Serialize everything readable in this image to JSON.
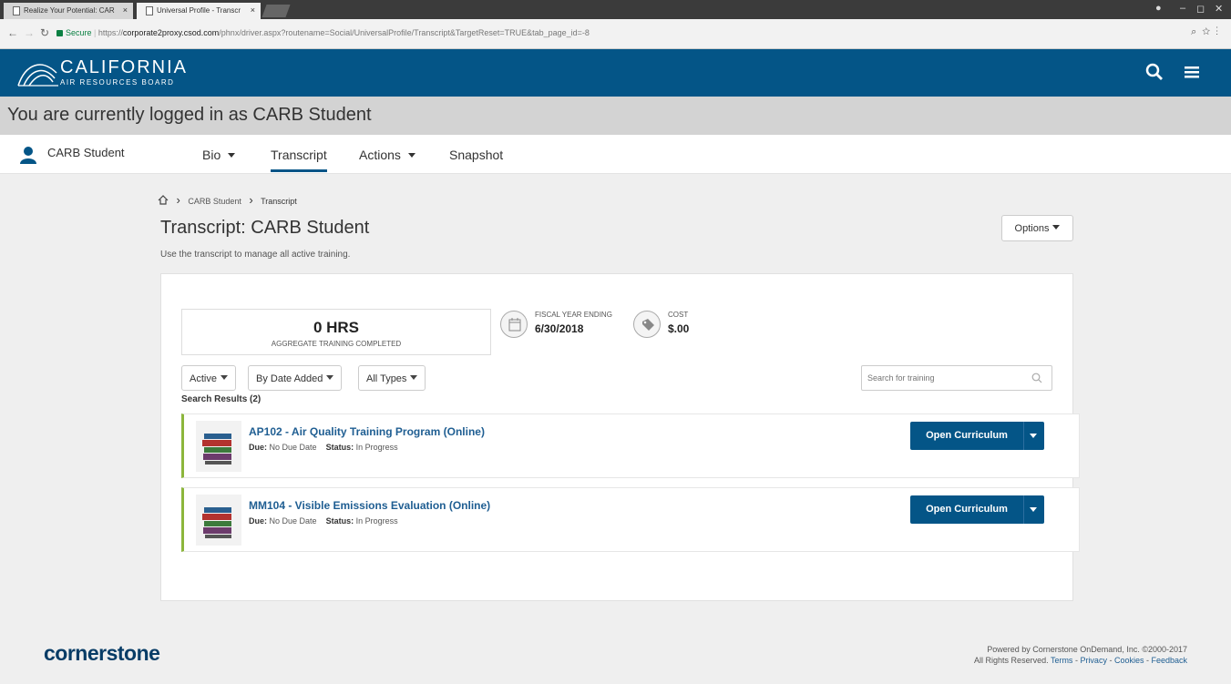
{
  "browser": {
    "tabs": [
      {
        "label": "Realize Your Potential: CAR"
      },
      {
        "label": "Universal Profile - Transcr"
      }
    ],
    "secure_label": "Secure",
    "url_scheme": "https://",
    "url_host": "corporate2proxy.csod.com",
    "url_path": "/phnx/driver.aspx?routename=Social/UniversalProfile/Transcript&TargetReset=TRUE&tab_page_id=-8"
  },
  "header": {
    "logo_title": "CALIFORNIA",
    "logo_subtitle": "AIR RESOURCES BOARD",
    "brand_color": "#045587"
  },
  "logged_in": {
    "text": "You are currently logged in as CARB Student"
  },
  "profile": {
    "name": "CARB Student",
    "tabs": [
      {
        "label": "Bio"
      },
      {
        "label": "Transcript"
      },
      {
        "label": "Actions"
      },
      {
        "label": "Snapshot"
      }
    ],
    "active_tab": "Transcript"
  },
  "breadcrumb": {
    "items": [
      "CARB Student",
      "Transcript"
    ]
  },
  "page": {
    "title": "Transcript: CARB Student",
    "subtitle": "Use the transcript to manage all active training.",
    "options_label": "Options"
  },
  "summary": {
    "hours": "0 HRS",
    "hours_label": "AGGREGATE TRAINING COMPLETED",
    "fiscal_label": "FISCAL YEAR ENDING",
    "fiscal_value": "6/30/2018",
    "cost_label": "COST",
    "cost_value": "$.00"
  },
  "filters": {
    "status": "Active",
    "sort": "By Date Added",
    "types": "All Types",
    "search_placeholder": "Search for training"
  },
  "results": {
    "label": "Search Results (2)",
    "due_label": "Due:",
    "status_label": "Status:",
    "items": [
      {
        "title": "AP102 - Air Quality Training Program (Online)",
        "due": "No Due Date",
        "status": "In Progress",
        "action": "Open Curriculum"
      },
      {
        "title": "MM104 - Visible Emissions Evaluation (Online)",
        "due": "No Due Date",
        "status": "In Progress",
        "action": "Open Curriculum"
      }
    ]
  },
  "footer": {
    "brand": "cornerstone",
    "powered": "Powered by Cornerstone OnDemand, Inc. ©2000-2017",
    "rights": "All Rights Reserved.",
    "links": [
      "Terms",
      "Privacy",
      "Cookies",
      "Feedback"
    ]
  }
}
